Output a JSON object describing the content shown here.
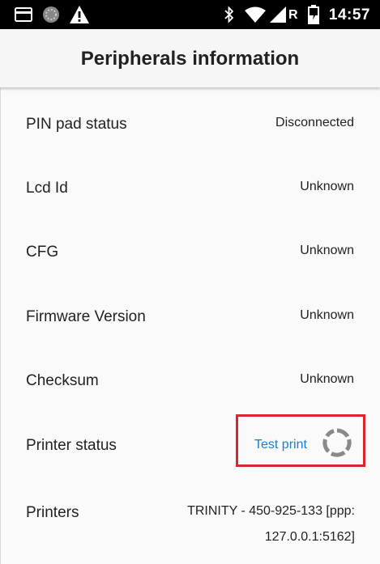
{
  "status_bar": {
    "time": "14:57",
    "network_letter": "R",
    "icons": [
      "sim-card-icon",
      "app-notification-icon",
      "warning-icon",
      "bluetooth-icon",
      "wifi-icon",
      "signal-icon",
      "battery-icon"
    ]
  },
  "header": {
    "title": "Peripherals information"
  },
  "rows": [
    {
      "label": "PIN pad status",
      "value": "Disconnected"
    },
    {
      "label": "Lcd Id",
      "value": "Unknown"
    },
    {
      "label": "CFG",
      "value": "Unknown"
    },
    {
      "label": "Firmware Version",
      "value": "Unknown"
    },
    {
      "label": "Checksum",
      "value": "Unknown"
    }
  ],
  "printer_status": {
    "label": "Printer status",
    "action_label": "Test print",
    "highlight_color": "#d9272e"
  },
  "printers": {
    "label": "Printers",
    "value": "TRINITY - 450-925-133 [ppp: 127.0.0.1:5162]"
  },
  "colors": {
    "link": "#1a7fd4",
    "status_bar": "#000000",
    "header_bg": "#f6f6f6"
  }
}
